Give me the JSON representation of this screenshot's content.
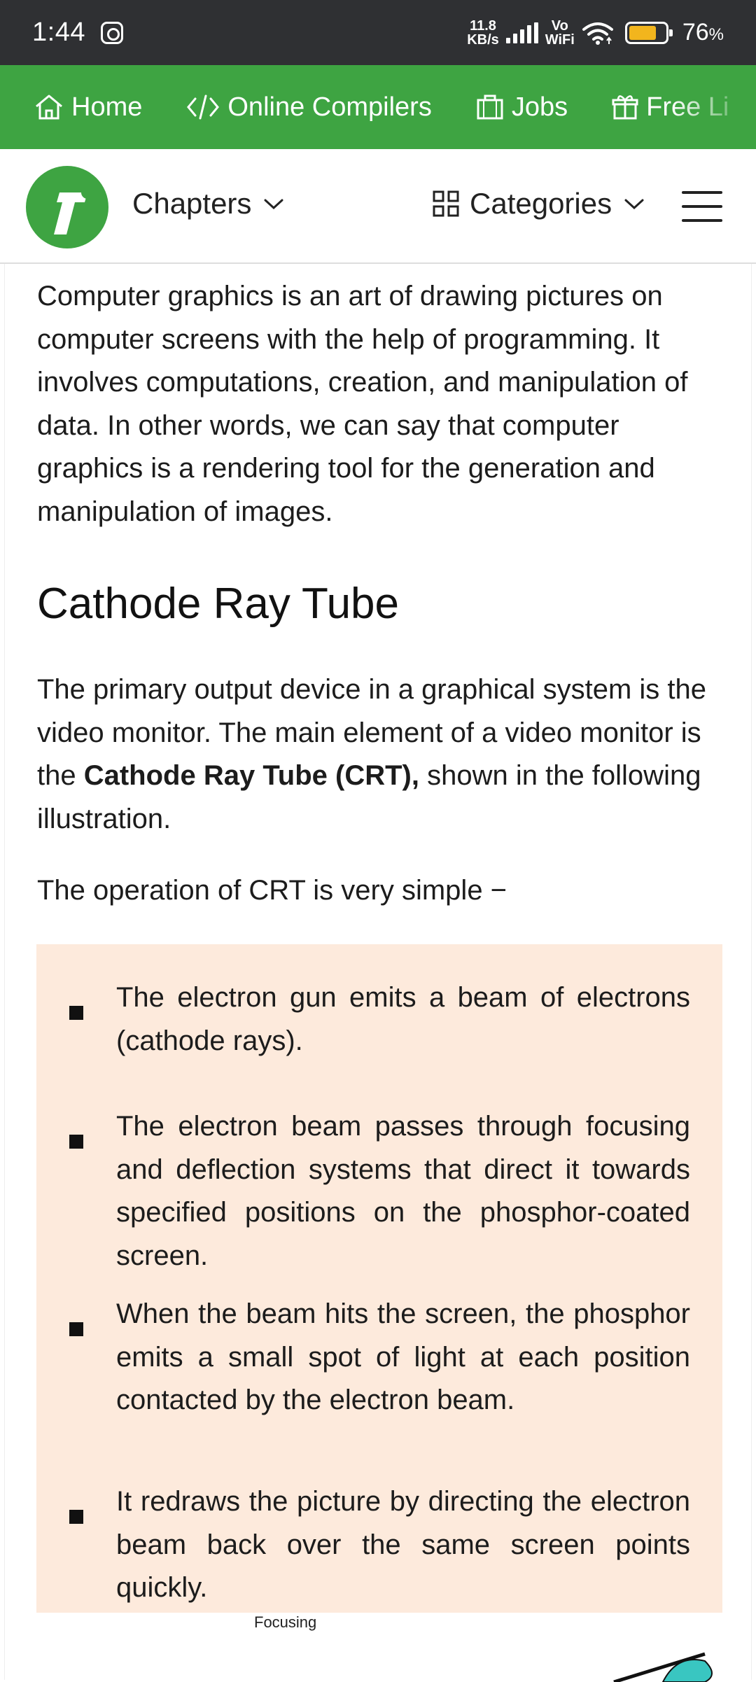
{
  "status_bar": {
    "time": "1:44",
    "speed_value": "11.8",
    "speed_unit": "KB/s",
    "vo_top": "Vo",
    "vo_bottom": "WiFi",
    "battery_pct": "76",
    "battery_pct_symbol": "%",
    "battery_level": 0.76,
    "battery_color": "#f2b51d"
  },
  "top_nav": {
    "items": [
      {
        "label": "Home",
        "icon": "home-icon"
      },
      {
        "label": "Online Compilers",
        "icon": "code-icon"
      },
      {
        "label": "Jobs",
        "icon": "briefcase-icon"
      },
      {
        "label": "Free Li",
        "icon": "gift-icon"
      }
    ],
    "bg_color": "#3ea442"
  },
  "header": {
    "chapters_label": "Chapters",
    "categories_label": "Categories"
  },
  "article": {
    "intro": "Computer graphics is an art of drawing pictures on computer screens with the help of programming. It involves computations, creation, and manipulation of data. In other words, we can say that computer graphics is a rendering tool for the generation and manipulation of images.",
    "heading": "Cathode Ray Tube",
    "para1_pre": "The primary output device in a graphical system is the video monitor. The main element of a video monitor is the ",
    "para1_bold": "Cathode Ray Tube (CRT),",
    "para1_post": " shown in the following illustration.",
    "para2": "The operation of CRT is very simple −",
    "bullets": [
      "The electron gun emits a beam of electrons (cathode rays).",
      "The electron beam passes through focusing and deflection systems that direct it towards specified positions on the phosphor-coated screen.",
      "When the beam hits the screen, the phosphor emits a small spot of light at each position contacted by the electron beam.",
      "It redraws the picture by directing the electron beam back over the same screen points quickly."
    ],
    "note_bg": "#fdeadc",
    "figure_label": "Focusing"
  }
}
